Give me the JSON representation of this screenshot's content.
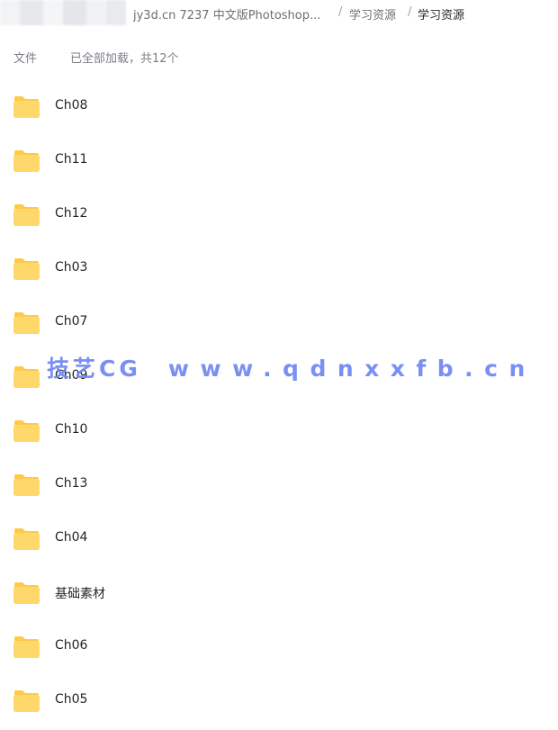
{
  "breadcrumb": {
    "items": [
      {
        "label": "jy3d.cn 7237 中文版Photoshop..."
      },
      {
        "label": "学习资源"
      },
      {
        "label": "学习资源"
      }
    ],
    "separator": "/"
  },
  "list_header": {
    "column_label": "文件",
    "load_status": "已全部加载，共12个"
  },
  "files": [
    {
      "name": "Ch08",
      "icon": "folder-icon"
    },
    {
      "name": "Ch11",
      "icon": "folder-icon"
    },
    {
      "name": "Ch12",
      "icon": "folder-icon"
    },
    {
      "name": "Ch03",
      "icon": "folder-icon"
    },
    {
      "name": "Ch07",
      "icon": "folder-icon"
    },
    {
      "name": "Ch09",
      "icon": "folder-icon"
    },
    {
      "name": "Ch10",
      "icon": "folder-icon"
    },
    {
      "name": "Ch13",
      "icon": "folder-icon"
    },
    {
      "name": "Ch04",
      "icon": "folder-icon"
    },
    {
      "name": "基础素材",
      "icon": "folder-icon"
    },
    {
      "name": "Ch06",
      "icon": "folder-icon"
    },
    {
      "name": "Ch05",
      "icon": "folder-icon"
    }
  ],
  "watermark": {
    "brand": "技艺CG",
    "url": "www.qdnxxfb.cn"
  },
  "colors": {
    "folder_front": "#ffd86b",
    "folder_back": "#ffc94a",
    "watermark": "#6f86f2",
    "text_primary": "#1f2329",
    "text_secondary": "#7b7f86"
  }
}
